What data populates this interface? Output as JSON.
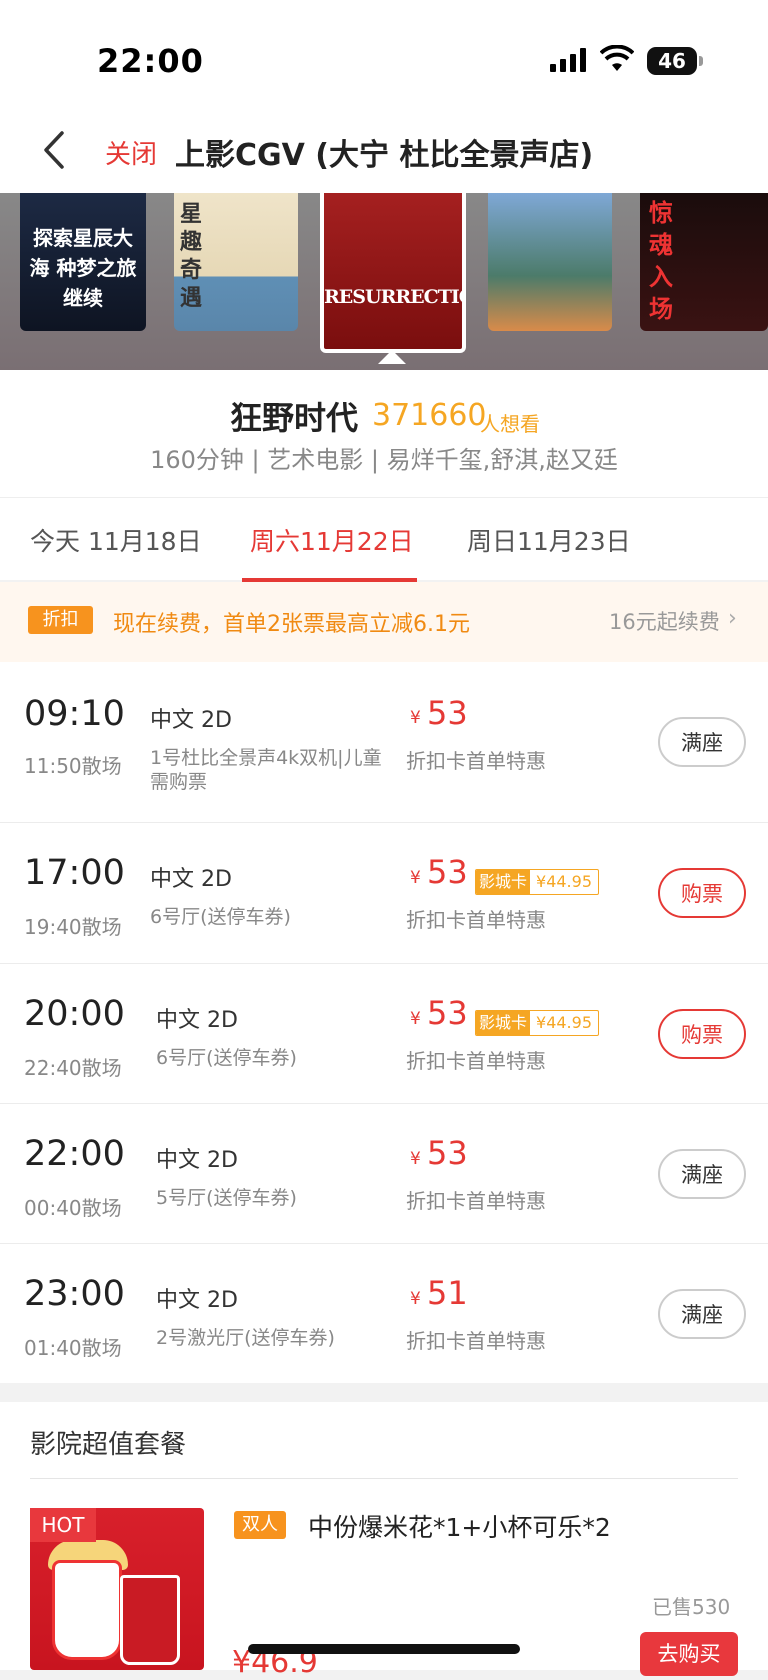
{
  "status_bar": {
    "time": "22:00",
    "battery": "46"
  },
  "header": {
    "close_label": "关闭",
    "title": "上影CGV (大宁 杜比全景声店)"
  },
  "posters": [
    {
      "text": "探索星辰大海 种梦之旅继续"
    },
    {
      "text": "星趣奇遇"
    },
    {
      "text": "RESURRECTION",
      "selected": true
    },
    {
      "text": ""
    },
    {
      "text": "惊魂入场"
    }
  ],
  "movie": {
    "name": "狂野时代",
    "want_count": "371660",
    "want_label": "人想看",
    "meta": "160分钟 | 艺术电影 | 易烊千玺,舒淇,赵又廷"
  },
  "tabs": [
    {
      "label": "今天 11月18日"
    },
    {
      "label": "周六11月22日",
      "active": true
    },
    {
      "label": "周日11月23日"
    }
  ],
  "promo": {
    "badge": "折扣",
    "text": "现在续费，首单2张票最高立减6.1元",
    "right": "16元起续费",
    "chevron": "›"
  },
  "showtimes": [
    {
      "start": "09:10",
      "end": "11:50散场",
      "lang": "中文 2D",
      "hall": "1号杜比全景声4k双机|儿童需购票",
      "yen": "¥",
      "price": "53",
      "card_label": "",
      "card_price": "",
      "discount": "折扣卡首单特惠",
      "button": "满座",
      "status": "full"
    },
    {
      "start": "17:00",
      "end": "19:40散场",
      "lang": "中文 2D",
      "hall": "6号厅(送停车券)",
      "yen": "¥",
      "price": "53",
      "card_label": "影城卡",
      "card_price": "¥44.95",
      "discount": "折扣卡首单特惠",
      "button": "购票",
      "status": "buy"
    },
    {
      "start": "20:00",
      "end": "22:40散场",
      "lang": "中文 2D",
      "hall": "6号厅(送停车券)",
      "yen": "¥",
      "price": "53",
      "card_label": "影城卡",
      "card_price": "¥44.95",
      "discount": "折扣卡首单特惠",
      "button": "购票",
      "status": "buy"
    },
    {
      "start": "22:00",
      "end": "00:40散场",
      "lang": "中文 2D",
      "hall": "5号厅(送停车券)",
      "yen": "¥",
      "price": "53",
      "card_label": "",
      "card_price": "",
      "discount": "折扣卡首单特惠",
      "button": "满座",
      "status": "full"
    },
    {
      "start": "23:00",
      "end": "01:40散场",
      "lang": "中文 2D",
      "hall": "2号激光厅(送停车券)",
      "yen": "¥",
      "price": "51",
      "card_label": "",
      "card_price": "",
      "discount": "折扣卡首单特惠",
      "button": "满座",
      "status": "full"
    }
  ],
  "package": {
    "section_title": "影院超值套餐",
    "hot": "HOT",
    "tag": "双人",
    "name": "中份爆米花*1+小杯可乐*2",
    "sold": "已售530",
    "price": "¥46.9",
    "buy": "去购买"
  },
  "colors": {
    "accent": "#e53935",
    "orange": "#f5a623"
  }
}
